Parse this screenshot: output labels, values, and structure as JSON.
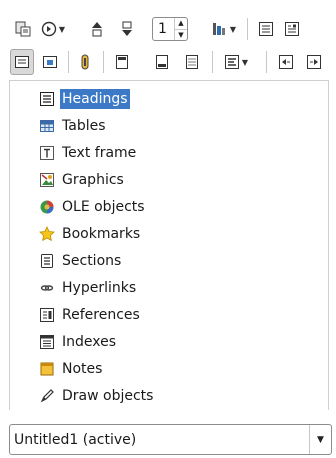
{
  "toolbar": {
    "page_number": "1",
    "icons_row1": [
      "navigator-toggle-icon",
      "navigation-icon",
      "previous-icon",
      "next-icon",
      "page-spinner",
      "drag-mode-icon",
      "list-box-icon",
      "content-view-icon"
    ],
    "icons_row2": [
      "content-navigation-view-icon",
      "list-box-on-off-icon",
      "reminder-icon",
      "header-icon",
      "footer-icon",
      "anchor-icon",
      "heading-levels-icon",
      "promote-level-icon",
      "demote-level-icon"
    ]
  },
  "tree": {
    "items": [
      {
        "label": "Headings",
        "icon": "headings-icon",
        "selected": true
      },
      {
        "label": "Tables",
        "icon": "tables-icon"
      },
      {
        "label": "Text frame",
        "icon": "text-frame-icon"
      },
      {
        "label": "Graphics",
        "icon": "graphics-icon"
      },
      {
        "label": "OLE objects",
        "icon": "ole-objects-icon"
      },
      {
        "label": "Bookmarks",
        "icon": "bookmarks-icon"
      },
      {
        "label": "Sections",
        "icon": "sections-icon"
      },
      {
        "label": "Hyperlinks",
        "icon": "hyperlinks-icon"
      },
      {
        "label": "References",
        "icon": "references-icon"
      },
      {
        "label": "Indexes",
        "icon": "indexes-icon"
      },
      {
        "label": "Notes",
        "icon": "notes-icon"
      },
      {
        "label": "Draw objects",
        "icon": "draw-objects-icon"
      }
    ]
  },
  "document_select": {
    "value": "Untitled1 (active)"
  },
  "colors": {
    "selection": "#3c7ac7",
    "border": "#d0d0d0"
  }
}
